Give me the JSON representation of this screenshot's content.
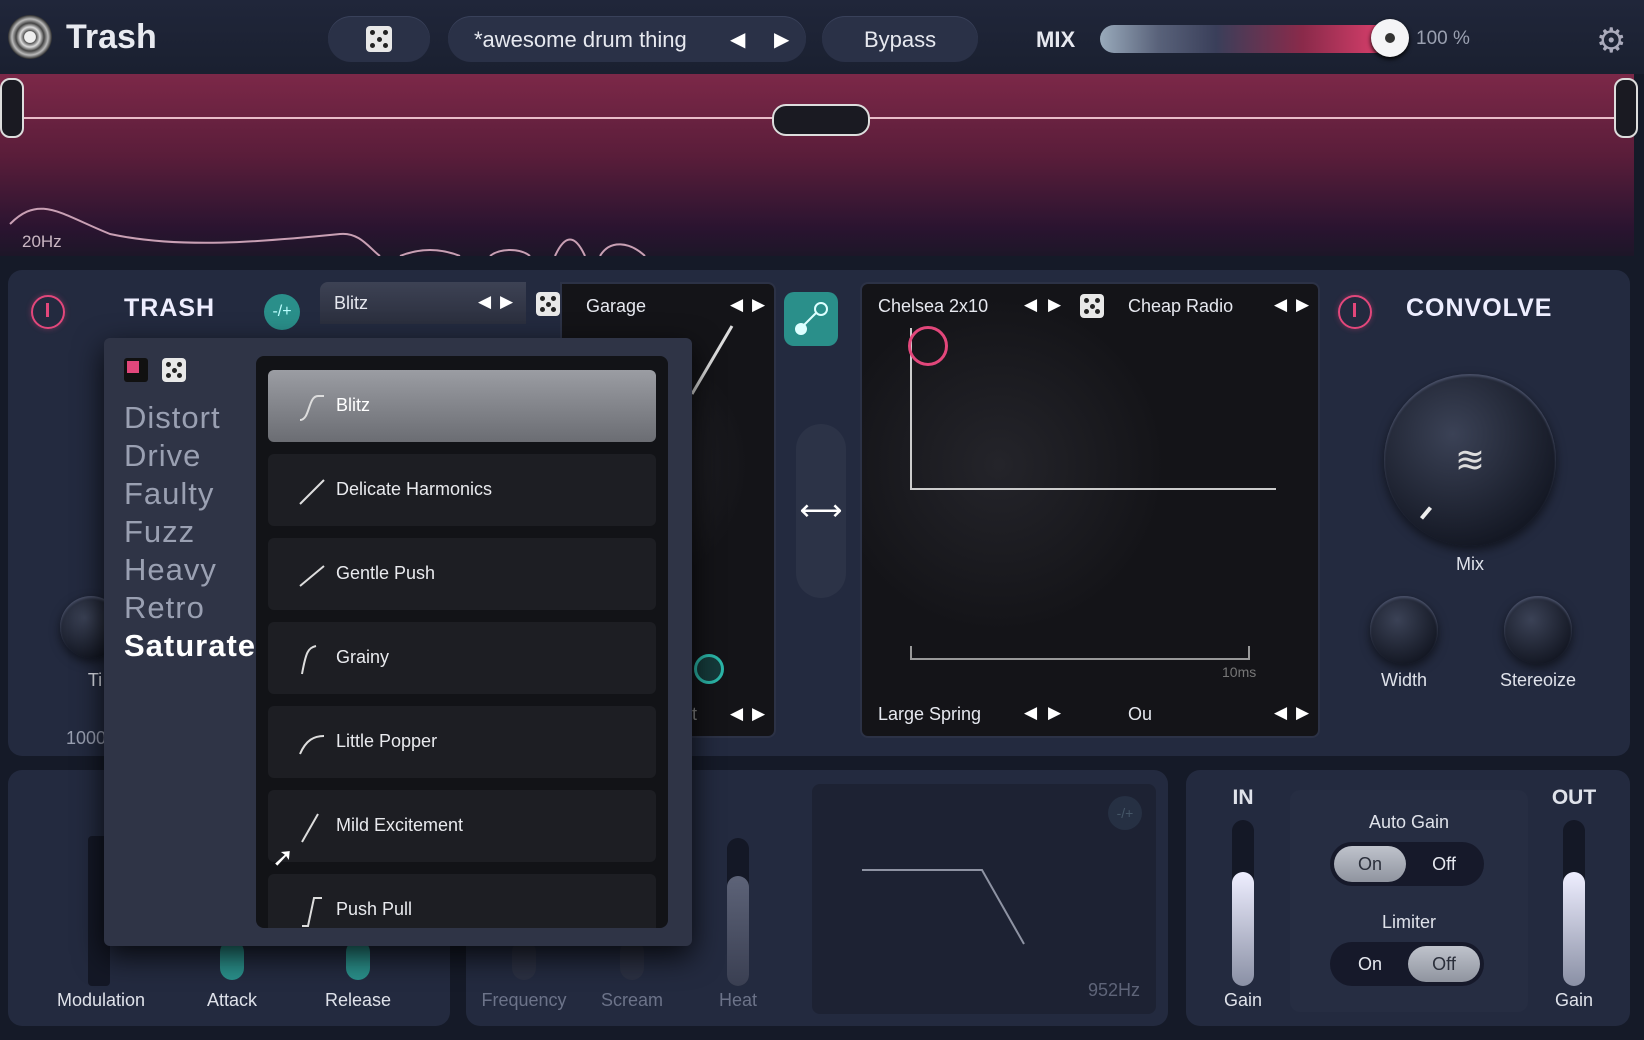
{
  "header": {
    "app_title": "Trash",
    "preset_name": "*awesome drum thing",
    "bypass_label": "Bypass",
    "mix_label": "MIX",
    "mix_value": "100 %",
    "mix_level": 1.0
  },
  "spectrum": {
    "freq_label": "20Hz"
  },
  "trash_module": {
    "title": "TRASH",
    "toggle_label": "-/+",
    "slot_a_name": "Blitz",
    "slot_b_name": "Garage",
    "partial_label_ti": "Ti",
    "partial_value": "1000",
    "partial_label_t": "t"
  },
  "convolve_module": {
    "title": "CONVOLVE",
    "ir_a": "Chelsea 2x10",
    "ir_b": "Cheap Radio",
    "ir_c": "Large Spring",
    "ir_d": "Ou",
    "time_label": "10ms",
    "mix_knob_label": "Mix",
    "width_label": "Width",
    "stereoize_label": "Stereoize"
  },
  "bottom": {
    "modulation_label": "Modulation",
    "attack_label": "Attack",
    "release_label": "Release",
    "frequency_label": "Frequency",
    "scream_label": "Scream",
    "heat_label": "Heat",
    "filter_freq": "952Hz",
    "filter_toggle": "-/+"
  },
  "io": {
    "in_label": "IN",
    "out_label": "OUT",
    "in_gain_label": "Gain",
    "out_gain_label": "Gain",
    "auto_gain_label": "Auto Gain",
    "limiter_label": "Limiter",
    "on_label": "On",
    "off_label": "Off",
    "auto_gain_state": "On",
    "limiter_state": "Off"
  },
  "dropdown": {
    "categories": [
      "Distort",
      "Drive",
      "Faulty",
      "Fuzz",
      "Heavy",
      "Retro",
      "Saturate"
    ],
    "selected_category": "Saturate",
    "presets": [
      "Blitz",
      "Delicate Harmonics",
      "Gentle Push",
      "Grainy",
      "Little Popper",
      "Mild Excitement",
      "Push Pull"
    ],
    "selected_preset": "Blitz"
  },
  "colors": {
    "accent_pink": "#e2477b",
    "accent_teal": "#2bb6a8",
    "background": "#151a28"
  }
}
